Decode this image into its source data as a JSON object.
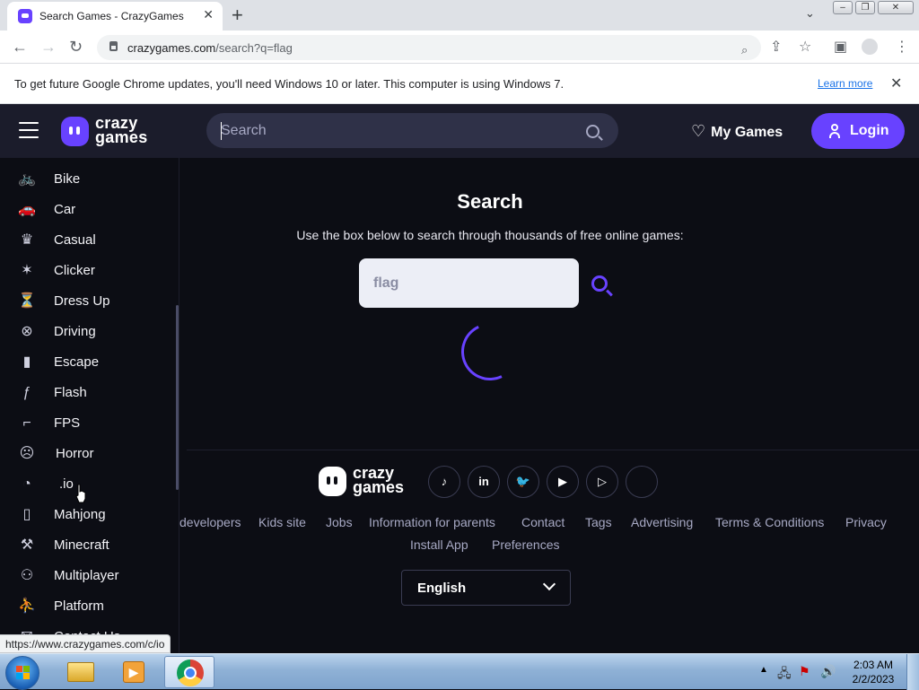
{
  "browser": {
    "tab_title": "Search Games - CrazyGames",
    "tab_close": "✕",
    "new_tab": "+",
    "url_domain": "crazygames.com",
    "url_path": "/search?q=flag",
    "infobar_message": "To get future Google Chrome updates, you'll need Windows 10 or later. This computer is using Windows 7.",
    "infobar_link": "Learn more",
    "infobar_close": "✕",
    "status_url": "https://www.crazygames.com/c/io"
  },
  "header": {
    "logo_line1": "crazy",
    "logo_line2": "games",
    "search_placeholder": "Search",
    "my_games": "My Games",
    "login": "Login"
  },
  "sidebar": {
    "items": [
      {
        "label": "Bike",
        "icon": "bike-icon",
        "glyph": "🚲"
      },
      {
        "label": "Car",
        "icon": "car-icon",
        "glyph": "🚗"
      },
      {
        "label": "Casual",
        "icon": "casual-icon",
        "glyph": "♛"
      },
      {
        "label": "Clicker",
        "icon": "clicker-icon",
        "glyph": "✶"
      },
      {
        "label": "Dress Up",
        "icon": "dress-up-icon",
        "glyph": "⏳"
      },
      {
        "label": "Driving",
        "icon": "steering-wheel-icon",
        "glyph": "⊗"
      },
      {
        "label": "Escape",
        "icon": "door-icon",
        "glyph": "▮"
      },
      {
        "label": "Flash",
        "icon": "flash-icon",
        "glyph": "ƒ"
      },
      {
        "label": "FPS",
        "icon": "gun-icon",
        "glyph": "⌐"
      },
      {
        "label": "Horror",
        "icon": "ghost-icon",
        "glyph": "☹"
      },
      {
        "label": ".io",
        "icon": "pacman-icon",
        "glyph": "◔"
      },
      {
        "label": "Mahjong",
        "icon": "mahjong-tile-icon",
        "glyph": "▯"
      },
      {
        "label": "Minecraft",
        "icon": "pickaxe-icon",
        "glyph": "⚒"
      },
      {
        "label": "Multiplayer",
        "icon": "users-icon",
        "glyph": "⚇"
      },
      {
        "label": "Platform",
        "icon": "platform-icon",
        "glyph": "⛹"
      },
      {
        "label": "Contact Us",
        "icon": "mail-icon",
        "glyph": "✉"
      }
    ]
  },
  "main": {
    "title": "Search",
    "subtitle": "Use the box below to search through thousands of free online games:",
    "search_value": "flag"
  },
  "footer": {
    "logo_line1": "crazy",
    "logo_line2": "games",
    "social": [
      {
        "name": "tiktok-icon",
        "glyph": "♪"
      },
      {
        "name": "linkedin-icon",
        "glyph": "in"
      },
      {
        "name": "twitter-icon",
        "glyph": "🐦"
      },
      {
        "name": "youtube-icon",
        "glyph": "▶"
      },
      {
        "name": "google-play-icon",
        "glyph": "▷"
      },
      {
        "name": "apple-icon",
        "glyph": ""
      }
    ],
    "links_row1": [
      "developers",
      "Kids site",
      "Jobs",
      "Information for parents",
      "Contact",
      "Tags",
      "Advertising",
      "Terms & Conditions",
      "Privacy"
    ],
    "links_row2": [
      "Install App",
      "Preferences"
    ],
    "language": "English"
  },
  "taskbar": {
    "time": "2:03 AM",
    "date": "2/2/2023"
  },
  "colors": {
    "accent": "#6842ff",
    "header_bg": "#1b1c2b",
    "page_bg": "#0c0d14"
  }
}
